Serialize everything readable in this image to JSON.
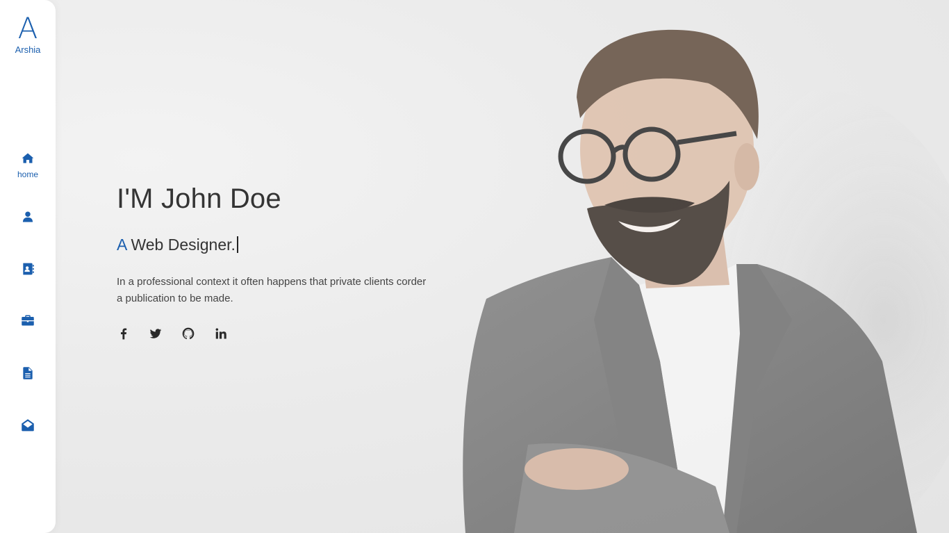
{
  "brand": {
    "logo_letter": "A",
    "logo_name": "Arshia",
    "accent_color": "#1b5fae"
  },
  "sidebar": {
    "items": [
      {
        "icon": "home-icon",
        "label": "home",
        "active": true
      },
      {
        "icon": "user-icon",
        "label": ""
      },
      {
        "icon": "address-book-icon",
        "label": ""
      },
      {
        "icon": "briefcase-icon",
        "label": ""
      },
      {
        "icon": "document-icon",
        "label": ""
      },
      {
        "icon": "envelope-open-icon",
        "label": ""
      }
    ]
  },
  "hero": {
    "title": "I'M John Doe",
    "subtitle_prefix": "A",
    "subtitle_text": "Web Designer.",
    "description": "In a professional context it often happens that private clients corder a publication to be made.",
    "socials": [
      {
        "icon": "facebook-icon"
      },
      {
        "icon": "twitter-icon"
      },
      {
        "icon": "github-icon"
      },
      {
        "icon": "linkedin-icon"
      }
    ]
  }
}
